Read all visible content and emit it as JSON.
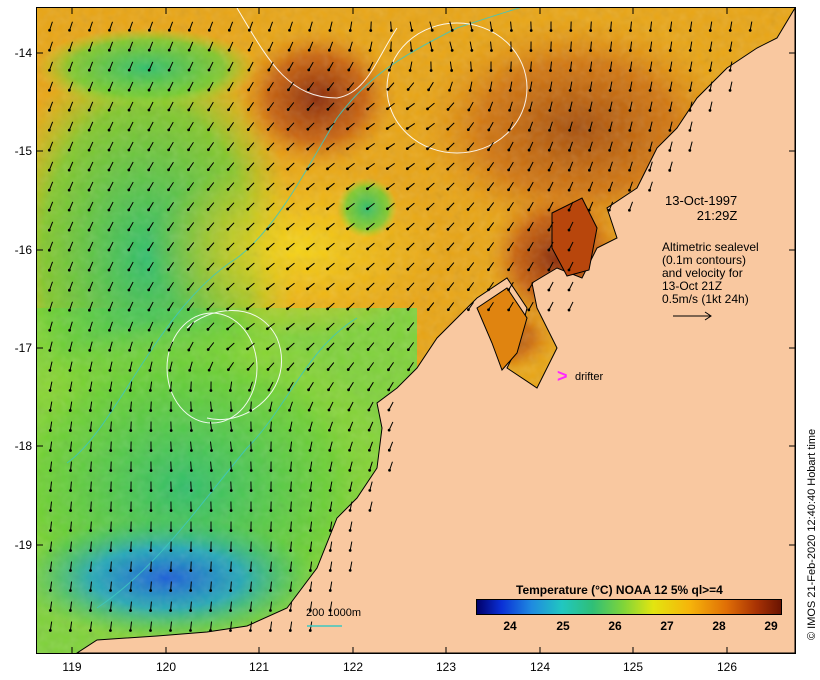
{
  "map": {
    "lat_ticks": [
      "-14",
      "-15",
      "-16",
      "-17",
      "-18",
      "-19"
    ],
    "lon_ticks": [
      "119",
      "120",
      "121",
      "122",
      "123",
      "124",
      "125",
      "126"
    ],
    "lon_range": [
      118.6,
      126.7
    ],
    "lat_range": [
      -13.6,
      -20.15
    ]
  },
  "annotations": {
    "date_line1": "13-Oct-1997",
    "date_line2": "21:29Z",
    "altim_line1": "Altimetric sealevel",
    "altim_line2": "(0.1m contours)",
    "altim_line3": "and velocity for",
    "altim_line4": "13-Oct 21Z",
    "altim_line5": "0.5m/s (1kt 24h)",
    "drifter_symbol": ">",
    "drifter_label": "drifter",
    "scale_label": "200  1000m"
  },
  "legend": {
    "title": "Temperature (°C) NOAA 12 5% ql>=4",
    "ticks": [
      "24",
      "25",
      "26",
      "27",
      "28",
      "29"
    ],
    "range": [
      23.4,
      29.2
    ]
  },
  "stamp": "© IMOS 21-Feb-2020 12:40:40 Hobart time",
  "colors": {
    "land": "#f9c8a0",
    "sst_warm": "#e08410",
    "sst_hot": "#a83a0a",
    "sst_mid": "#f4c414",
    "sst_cool": "#6ad032",
    "sst_cold": "#1ea5c4",
    "contour": "#ffffff",
    "isobath": "#3ec8c0",
    "drifter": "#ff28ff"
  }
}
